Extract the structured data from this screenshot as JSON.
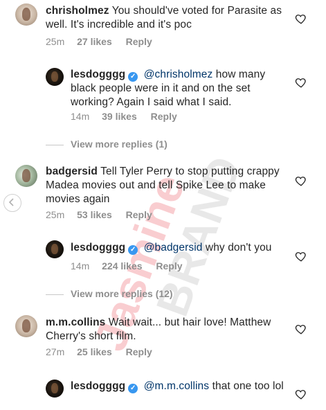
{
  "watermark": {
    "line1": "Jasmine",
    "line2": "BRAND"
  },
  "comments": [
    {
      "username": "chrisholmez",
      "text": "You should've voted for Parasite as well. It's incredible and it's poc",
      "time": "25m",
      "likes": "27 likes",
      "reply": "Reply"
    },
    {
      "username": "lesdogggg",
      "verified": true,
      "mention": "@chrisholmez",
      "text": "how many black people were in it and on the set working? Again I said what I said.",
      "time": "14m",
      "likes": "39 likes",
      "reply": "Reply"
    },
    {
      "view_more": "View more replies (1)"
    },
    {
      "username": "badgersid",
      "text": "Tell Tyler Perry to stop putting crappy Madea movies out and tell Spike Lee to make movies again",
      "time": "25m",
      "likes": "53 likes",
      "reply": "Reply"
    },
    {
      "username": "lesdogggg",
      "verified": true,
      "mention": "@badgersid",
      "text": "why don't you",
      "time": "14m",
      "likes": "224 likes",
      "reply": "Reply"
    },
    {
      "view_more": "View more replies (12)"
    },
    {
      "username": "m.m.collins",
      "text": "Wait wait... but hair love! Matthew Cherry's short film.",
      "time": "27m",
      "likes": "25 likes",
      "reply": "Reply"
    },
    {
      "username": "lesdogggg",
      "verified": true,
      "mention": "@m.m.collins",
      "text": "that one too lol"
    }
  ],
  "colors": {
    "text": "#262626",
    "meta": "#8e8e8e",
    "mention": "#003569",
    "verified": "#3897f0",
    "watermark": "#e8212f"
  }
}
